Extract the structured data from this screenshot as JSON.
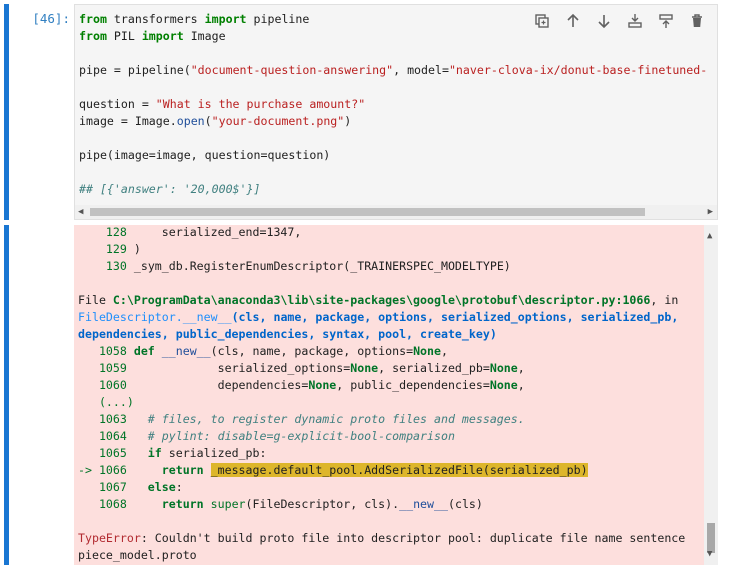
{
  "input_cell": {
    "prompt": "[46]:",
    "toolbar": {
      "duplicate_icon": "duplicate-icon",
      "move_up_icon": "arrow-up-icon",
      "move_down_icon": "arrow-down-icon",
      "insert_above_icon": "insert-above-icon",
      "insert_below_icon": "insert-below-icon",
      "delete_icon": "trash-icon"
    },
    "code": {
      "l1_kw1": "from",
      "l1_mod": " transformers ",
      "l1_kw2": "import",
      "l1_name": " pipeline",
      "l2_kw1": "from",
      "l2_mod": " PIL ",
      "l2_kw2": "import",
      "l2_name": " Image",
      "l3_a": "pipe = pipeline(",
      "l3_s1": "\"document-question-answering\"",
      "l3_b": ", model=",
      "l3_s2": "\"naver-clova-ix/donut-base-finetuned-",
      "l4_a": "question = ",
      "l4_s": "\"What is the purchase amount?\"",
      "l5_a": "image = Image.",
      "l5_fn": "open",
      "l5_b": "(",
      "l5_s": "\"your-document.png\"",
      "l5_c": ")",
      "l6": "pipe(image=image, question=question)",
      "l7": "## [{'answer': '20,000$'}]"
    }
  },
  "output_cell": {
    "t1_n": "    128",
    "t1_c": "     serialized_end=1347,",
    "t2_n": "    129",
    "t2_c": " )",
    "t3_n": "    130",
    "t3_c": " _sym_db.RegisterEnumDescriptor(_TRAINERSPEC_MODELTYPE)",
    "f_label": "File ",
    "f_path": "C:\\ProgramData\\anaconda3\\lib\\site-packages\\google\\protobuf\\descriptor.py:1066",
    "f_in": ", in",
    "f2_cls": "FileDescriptor.",
    "f2_fn": "__new__",
    "f2_args": "(cls, name, package, options, serialized_options, serialized_pb,",
    "f3": "dependencies, public_dependencies, syntax, pool, create_key)",
    "d1_n": "   1058 ",
    "d1_kw": "def",
    "d1_sp": " ",
    "d1_fn": "__new__",
    "d1_a": "(cls, name, package, options=",
    "d1_none": "None",
    "d1_b": ",",
    "d2_n": "   1059 ",
    "d2_a": "            serialized_options=",
    "d2_none1": "None",
    "d2_b": ", serialized_pb=",
    "d2_none2": "None",
    "d2_c": ",",
    "d3_n": "   1060 ",
    "d3_a": "            dependencies=",
    "d3_none1": "None",
    "d3_b": ", public_dependencies=",
    "d3_none2": "None",
    "d3_c": ",",
    "dots": "   (...)",
    "c1_n": "   1063 ",
    "c1_c": "  # files, to register dynamic proto files and messages.",
    "c2_n": "   1064 ",
    "c2_c": "  # pylint: disable=g-explicit-bool-comparison",
    "c3_n": "   1065 ",
    "c3_kw": "  if",
    "c3_c": " serialized_pb:",
    "arrow_n": "-> 1066 ",
    "arrow_kw": "    return",
    "arrow_sp": " ",
    "arrow_hl": "_message.default_pool.AddSerializedFile(serialized_pb)",
    "e1_n": "   1067 ",
    "e1_kw": "  else",
    "e1_c": ":",
    "e2_n": "   1068 ",
    "e2_kw": "    return",
    "e2_a": " ",
    "e2_sup": "super",
    "e2_b": "(FileDescriptor, cls).",
    "e2_fn": "__new__",
    "e2_c": "(cls)",
    "err_name": "TypeError",
    "err_msg": ": Couldn't build proto file into descriptor pool: duplicate file name sentence",
    "err_msg2": "piece_model.proto"
  }
}
